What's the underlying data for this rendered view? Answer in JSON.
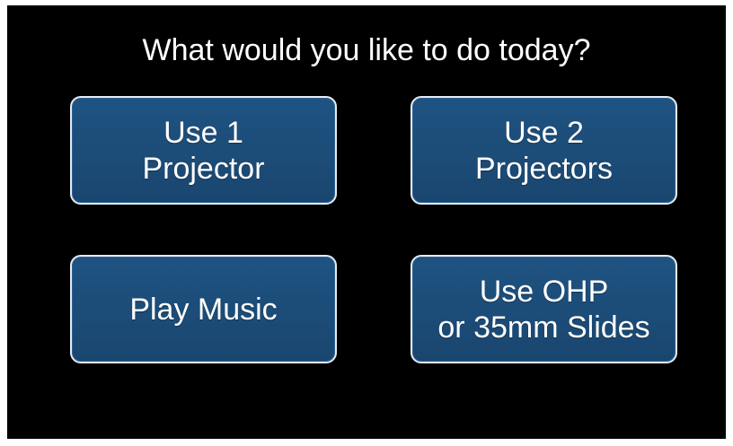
{
  "prompt": "What would you like to do today?",
  "buttons": {
    "one_projector": {
      "line1": "Use 1",
      "line2": "Projector"
    },
    "two_projectors": {
      "line1": "Use 2",
      "line2": "Projectors"
    },
    "play_music": {
      "label": "Play Music"
    },
    "ohp_slides": {
      "line1": "Use OHP",
      "line2": "or 35mm Slides"
    }
  },
  "colors": {
    "background": "#000000",
    "button_fill": "#1c4c79",
    "button_border": "#e6ebf2",
    "text": "#ffffff"
  }
}
